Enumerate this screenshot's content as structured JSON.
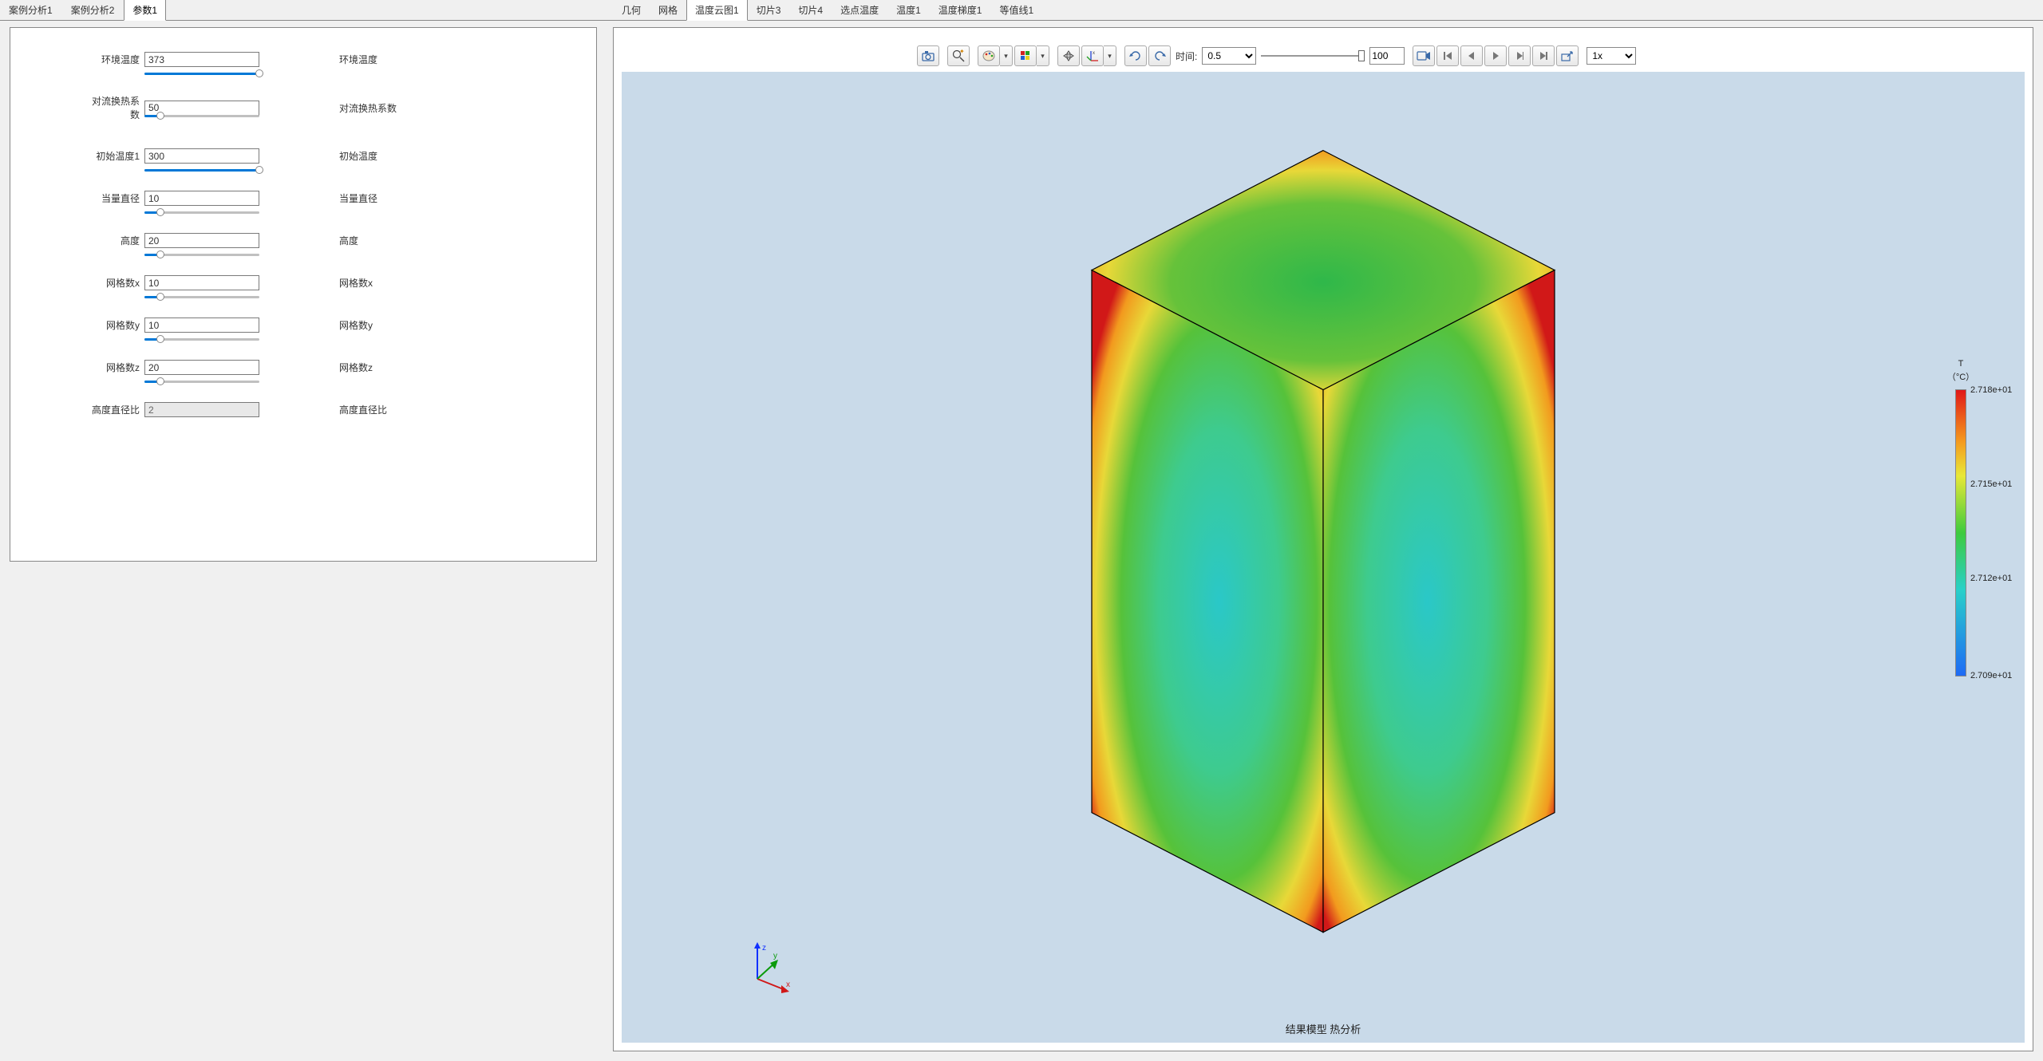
{
  "leftTabs": [
    "案例分析1",
    "案例分析2",
    "参数1"
  ],
  "leftActive": 2,
  "params": [
    {
      "label": "环境温度",
      "value": "373",
      "desc": "环境温度",
      "fill": 144,
      "readonly": false
    },
    {
      "label": "对流换热系数",
      "value": "50",
      "desc": "对流换热系数",
      "fill": 20,
      "readonly": false
    },
    {
      "label": "初始温度1",
      "value": "300",
      "desc": "初始温度",
      "fill": 144,
      "readonly": false
    },
    {
      "label": "当量直径",
      "value": "10",
      "desc": "当量直径",
      "fill": 20,
      "readonly": false
    },
    {
      "label": "高度",
      "value": "20",
      "desc": "高度",
      "fill": 20,
      "readonly": false
    },
    {
      "label": "网格数x",
      "value": "10",
      "desc": "网格数x",
      "fill": 20,
      "readonly": false
    },
    {
      "label": "网格数y",
      "value": "10",
      "desc": "网格数y",
      "fill": 20,
      "readonly": false
    },
    {
      "label": "网格数z",
      "value": "20",
      "desc": "网格数z",
      "fill": 20,
      "readonly": false
    },
    {
      "label": "高度直径比",
      "value": "2",
      "desc": "高度直径比",
      "fill": 0,
      "readonly": true
    }
  ],
  "rightTabs": [
    "几何",
    "网格",
    "温度云图1",
    "切片3",
    "切片4",
    "选点温度",
    "温度1",
    "温度梯度1",
    "等值线1"
  ],
  "rightActive": 2,
  "toolbar": {
    "timeLabel": "时间:",
    "timeValue": "0.5",
    "spinValue": "100",
    "speedValue": "1x"
  },
  "resultLabel": "结果模型 热分析",
  "colorbar": {
    "title": "T",
    "unit": "（°C）",
    "ticks": [
      {
        "pos": 0,
        "label": "2.718e+01"
      },
      {
        "pos": 33,
        "label": "2.715e+01"
      },
      {
        "pos": 66,
        "label": "2.712e+01"
      },
      {
        "pos": 100,
        "label": "2.709e+01"
      }
    ]
  },
  "axis": {
    "x": "x",
    "y": "y",
    "z": "z"
  }
}
